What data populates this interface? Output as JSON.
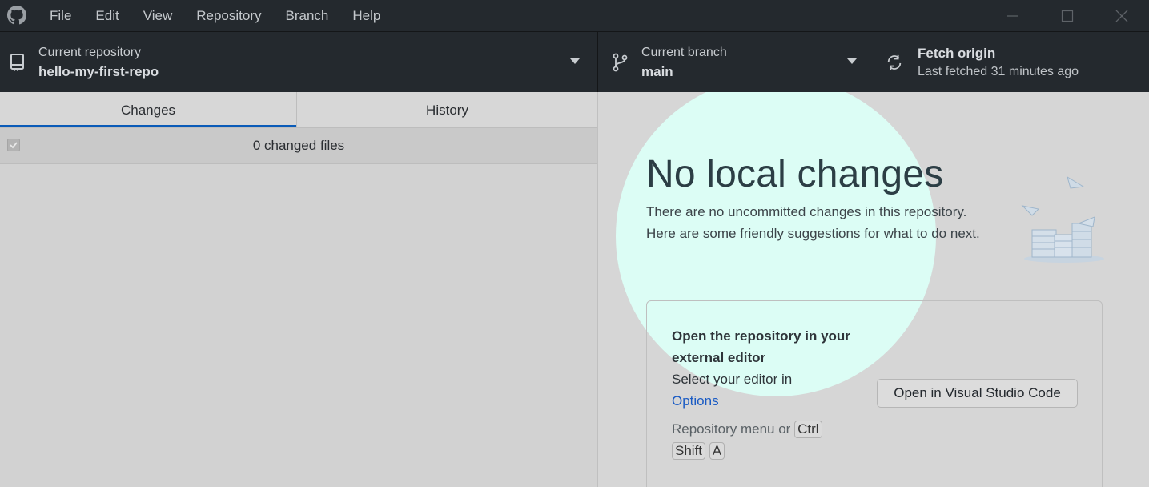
{
  "titlebar": {
    "menu": [
      "File",
      "Edit",
      "View",
      "Repository",
      "Branch",
      "Help"
    ]
  },
  "toolbar": {
    "repo": {
      "title": "Current repository",
      "value": "hello-my-first-repo"
    },
    "branch": {
      "title": "Current branch",
      "value": "main"
    },
    "fetch": {
      "title": "Fetch origin",
      "value": "Last fetched 31 minutes ago"
    }
  },
  "left": {
    "tabs": [
      "Changes",
      "History"
    ],
    "changed_files": "0 changed files"
  },
  "right": {
    "title": "No local changes",
    "description": "There are no uncommitted changes in this repository. Here are some friendly suggestions for what to do next.",
    "suggestion": {
      "title": "Open the repository in your external editor",
      "desc_prefix": "Select your editor in",
      "link": "Options",
      "shortcut_prefix": "Repository menu or",
      "keys": [
        "Ctrl",
        "Shift",
        "A"
      ],
      "button": "Open in Visual Studio Code"
    }
  },
  "colors": {
    "titlebar_bg": "#24292e",
    "accent": "#0a5bb8",
    "highlight": "#dcfdf5"
  }
}
